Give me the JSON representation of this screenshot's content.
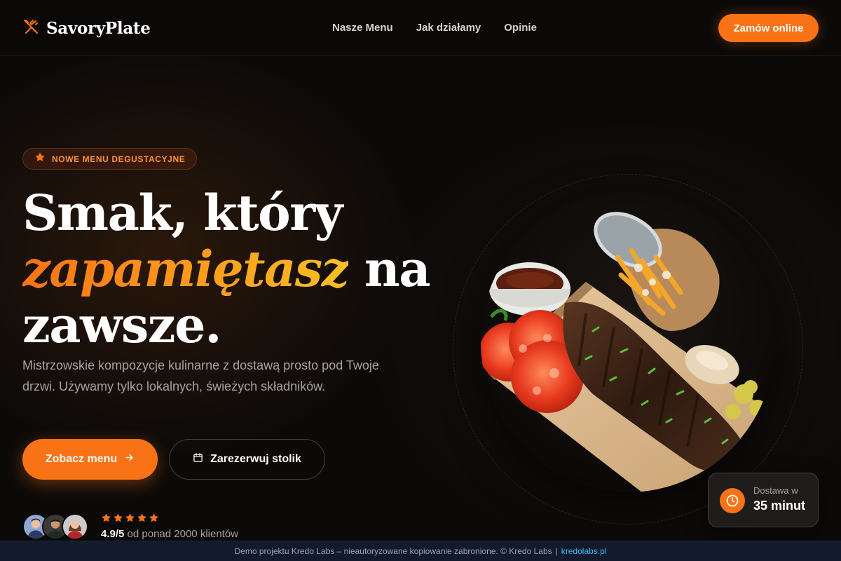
{
  "brand": {
    "name": "SavoryPlate",
    "icon": "utensils-icon",
    "accent_color": "#f97316"
  },
  "nav": {
    "links": [
      "Nasze Menu",
      "Jak działamy",
      "Opinie"
    ],
    "cta_label": "Zamów online"
  },
  "hero": {
    "badge": {
      "icon": "star-icon",
      "label": "NOWE MENU DEGUSTACYJNE"
    },
    "headline": {
      "line_start": "Smak, który",
      "accent": "zapamiętasz",
      "middle": "na",
      "end": "zawsze."
    },
    "subtitle": "Mistrzowskie kompozycje kulinarne z dostawą prosto pod Twoje drzwi. Używamy tylko lokalnych, świeżych składników.",
    "primary_button": {
      "label": "Zobacz menu",
      "icon": "arrow-right-icon"
    },
    "secondary_button": {
      "label": "Zarezerwuj stolik",
      "icon": "calendar-icon"
    }
  },
  "rating": {
    "stars": 5,
    "score": "4.9/5",
    "text": "od ponad 2000 klientów",
    "avatars_count": 3
  },
  "delivery": {
    "icon": "clock-icon",
    "label": "Dostawa w",
    "value": "35 minut"
  },
  "footer": {
    "text": "Demo projektu Kredo Labs – nieautoryzowane kopiowanie zabronione. © Kredo Labs",
    "separator": "|",
    "link": "kredolabs.pl"
  }
}
